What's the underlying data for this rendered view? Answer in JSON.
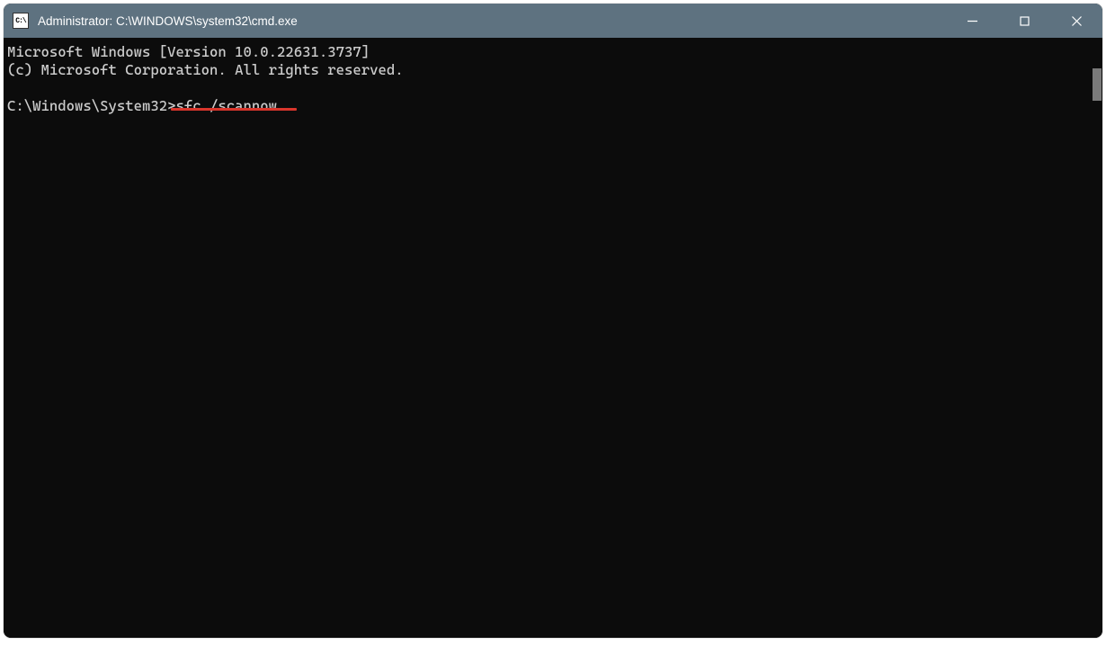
{
  "window": {
    "icon_text": "C:\\",
    "title": "Administrator: C:\\WINDOWS\\system32\\cmd.exe"
  },
  "terminal": {
    "line1": "Microsoft Windows [Version 10.0.22631.3737]",
    "line2": "(c) Microsoft Corporation. All rights reserved.",
    "blank": "",
    "prompt": "C:\\Windows\\System32>",
    "command": "sfc /scannow"
  },
  "annotation": {
    "underline_color": "#d9362c"
  }
}
